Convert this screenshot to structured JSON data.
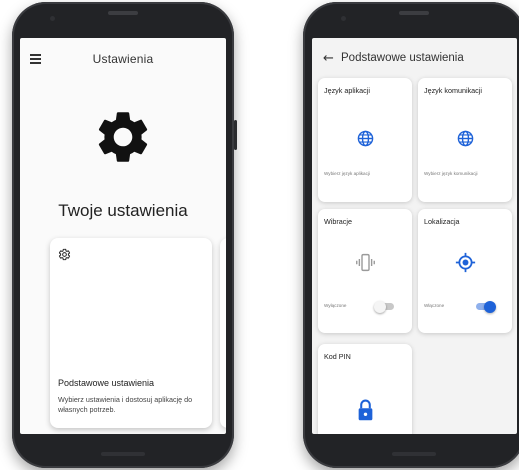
{
  "left_screen": {
    "topbar_title": "Ustawienia",
    "hero_title": "Twoje ustawienia",
    "card": {
      "title": "Podstawowe ustawienia",
      "description": "Wybierz ustawienia i dostosuj aplikację do własnych potrzeb."
    }
  },
  "right_screen": {
    "topbar_title": "Podstawowe ustawienia",
    "tiles": [
      {
        "title": "Język aplikacji",
        "subtitle": "Wybierz język aplikacji",
        "icon": "globe-icon"
      },
      {
        "title": "Język komunikacji",
        "subtitle": "Wybierz język komunikacji",
        "icon": "globe-icon"
      },
      {
        "title": "Wibracje",
        "subtitle": "Wyłączone",
        "icon": "vibration-icon",
        "toggle_on": false
      },
      {
        "title": "Lokalizacja",
        "subtitle": "Włączone",
        "icon": "location-icon",
        "toggle_on": true
      },
      {
        "title": "Kod PIN",
        "subtitle": "",
        "icon": "lock-icon"
      }
    ]
  },
  "colors": {
    "accent": "#1e62d8",
    "toggle_off_track": "#c8c8c8",
    "toggle_off_knob": "#f5f5f5"
  }
}
